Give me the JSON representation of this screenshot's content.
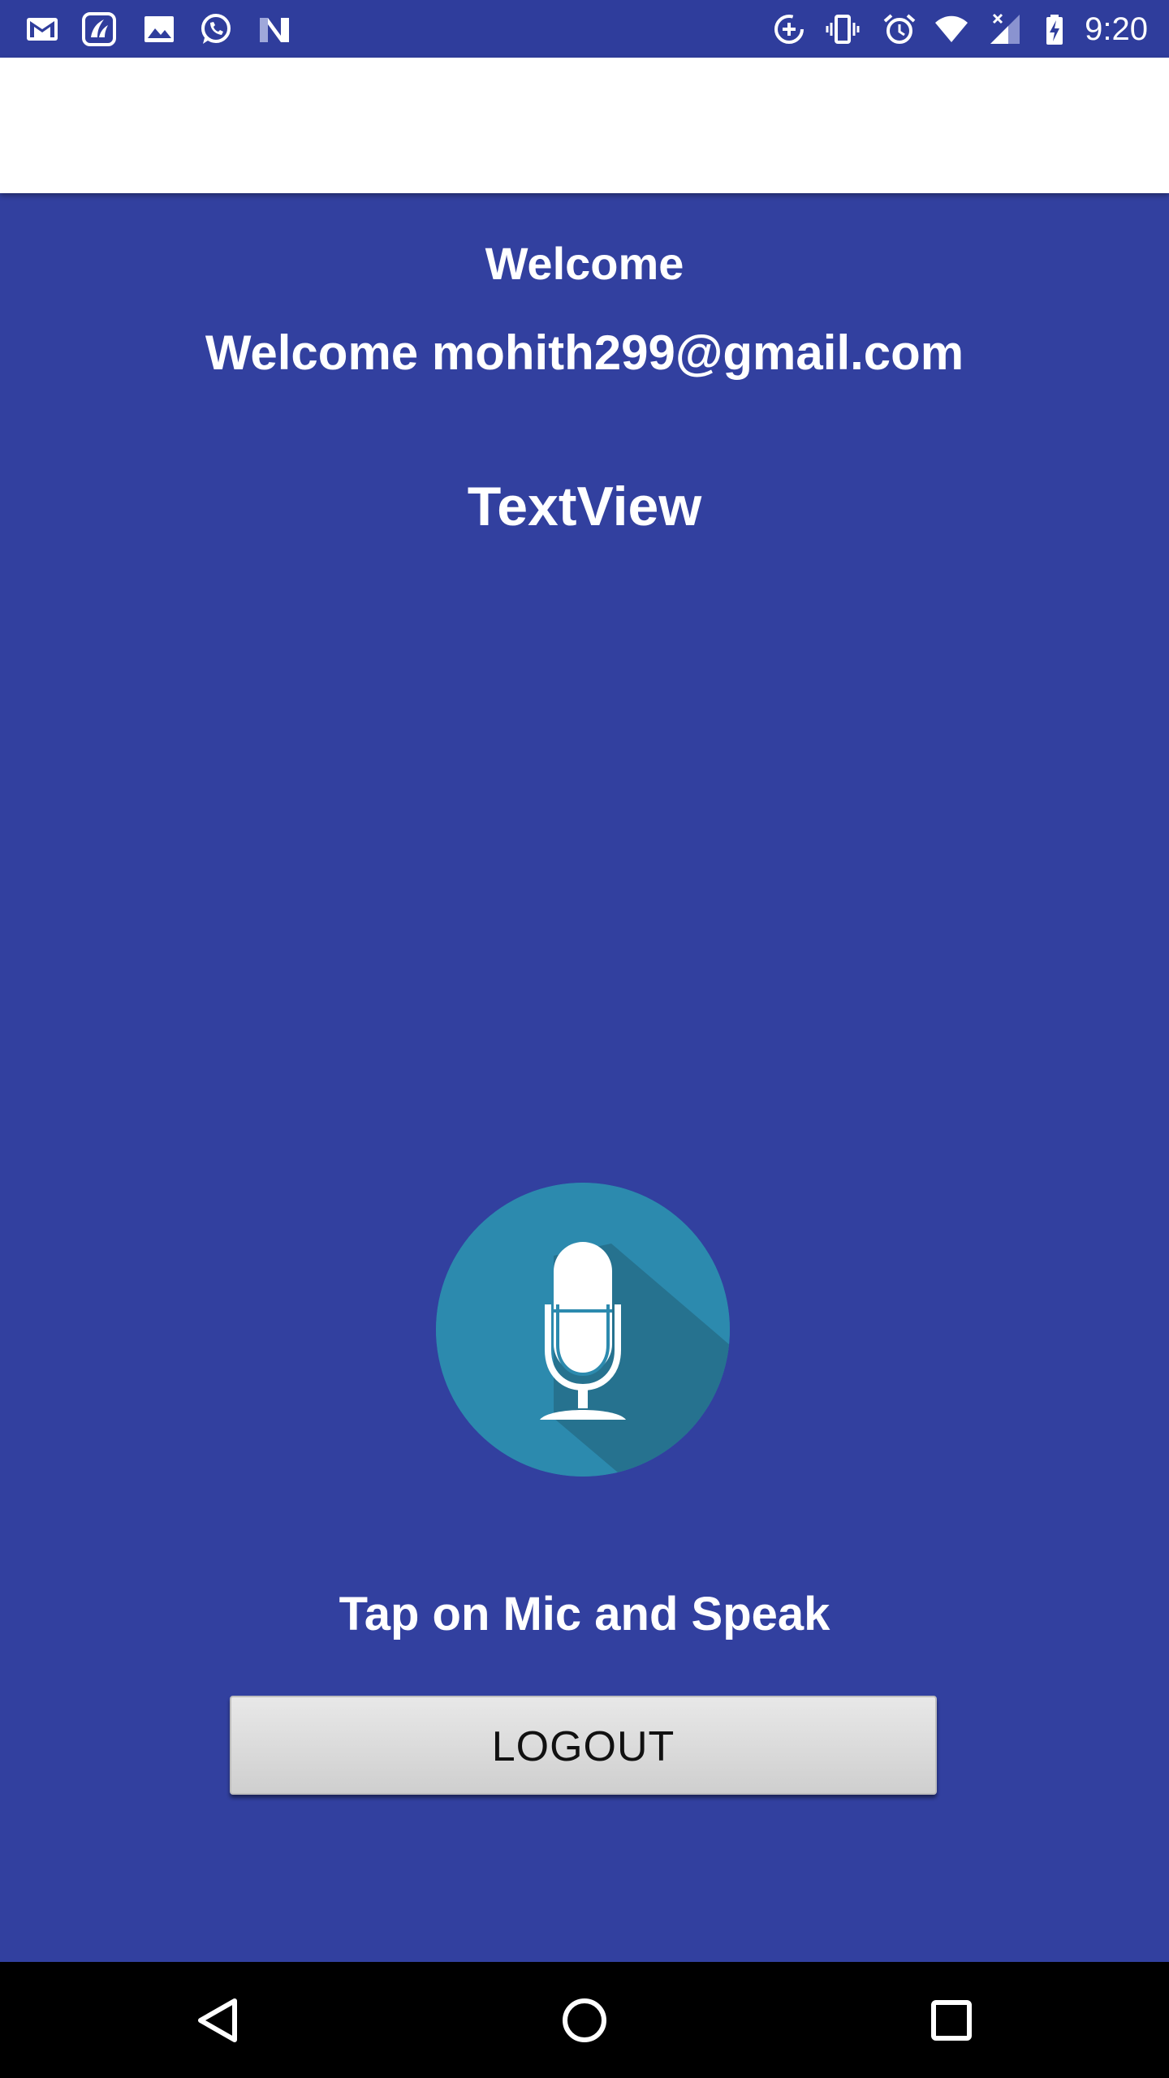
{
  "status_bar": {
    "time": "9:20",
    "left_icons": [
      "gmail-icon",
      "saavn-icon",
      "gallery-icon",
      "whatsapp-icon",
      "n-app-icon"
    ],
    "right_icons": [
      "data-saver-icon",
      "vibrate-icon",
      "alarm-icon",
      "wifi-icon",
      "signal-icon",
      "battery-charging-icon"
    ]
  },
  "main": {
    "welcome_title": "Welcome",
    "welcome_user": "Welcome mohith299@gmail.com",
    "result_text": "TextView",
    "mic_icon": "microphone-icon",
    "hint": "Tap on Mic and Speak",
    "logout_label": "LOGOUT"
  },
  "nav_bar": {
    "buttons": [
      "back-icon",
      "home-icon",
      "recents-icon"
    ]
  },
  "colors": {
    "background": "#32409F",
    "status_bar": "#2F3D9C",
    "app_bar": "#FFFFFF",
    "mic_circle": "#2C8AAE",
    "mic_shadow": "#26728F",
    "button": "#D9D9D9",
    "nav_bar": "#000000"
  }
}
